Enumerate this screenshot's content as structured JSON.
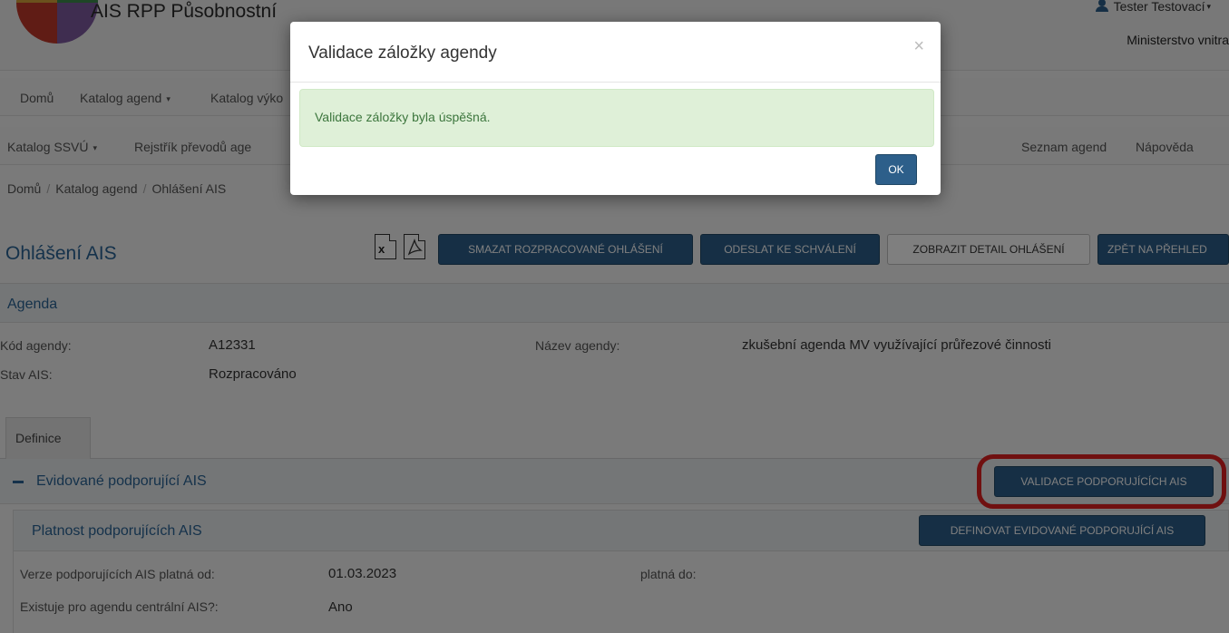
{
  "header": {
    "app_title": "AIS RPP Působnostní",
    "user_name": "Tester Testovací",
    "user_caret": "▾",
    "organization": "Ministerstvo vnitra"
  },
  "nav1": [
    {
      "label": "Domů",
      "has_caret": false
    },
    {
      "label": "Katalog agend",
      "has_caret": true
    },
    {
      "label": "Katalog výko",
      "has_caret": false
    }
  ],
  "nav2": {
    "left": [
      {
        "label": "Katalog SSVÚ",
        "has_caret": true
      },
      {
        "label": "Rejstřík převodů age",
        "has_caret": false
      }
    ],
    "right": [
      {
        "label": "Seznam agend"
      },
      {
        "label": "Nápověda"
      }
    ]
  },
  "caret_glyph": "▾",
  "breadcrumb": [
    "Domů",
    "Katalog agend",
    "Ohlášení AIS"
  ],
  "breadcrumb_sep": "/",
  "page": {
    "title": "Ohlášení AIS",
    "icons": [
      "excel-icon",
      "pdf-icon"
    ],
    "buttons": {
      "delete_draft": "SMAZAT ROZPRACOVANÉ OHLÁŠENÍ",
      "send_for_approval": "ODESLAT KE SCHVÁLENÍ",
      "show_detail": "ZOBRAZIT DETAIL OHLÁŠENÍ",
      "back_to_overview": "ZPĚT NA PŘEHLED"
    }
  },
  "agenda": {
    "panel_title": "Agenda",
    "code_label": "Kód agendy:",
    "code_value": "A12331",
    "name_label": "Název agendy:",
    "name_value": "zkušební agenda MV využívající průřezové činnosti",
    "state_label": "Stav AIS:",
    "state_value": "Rozpracováno"
  },
  "tabs": [
    {
      "label": "Definice",
      "active": true
    }
  ],
  "evidovane": {
    "title": "Evidované podporující AIS",
    "validate_button": "VALIDACE PODPORUJÍCÍCH AIS"
  },
  "platnost": {
    "title": "Platnost podporujících AIS",
    "define_button": "DEFINOVAT EVIDOVANÉ PODPORUJÍCÍ AIS",
    "valid_from_label": "Verze podporujících AIS platná od:",
    "valid_from_value": "01.03.2023",
    "valid_to_label": "platná do:",
    "valid_to_value": "",
    "central_label": "Existuje pro agendu centrální AIS?:",
    "central_value": "Ano"
  },
  "modal": {
    "title": "Validace záložky agendy",
    "close": "×",
    "message": "Validace záložky byla úspěšná.",
    "ok": "OK"
  },
  "colors": {
    "primary": "#2d5f8a",
    "link": "#2a6496",
    "success_bg": "#dff0d8",
    "success_text": "#3c763d",
    "highlight": "#e02020"
  }
}
